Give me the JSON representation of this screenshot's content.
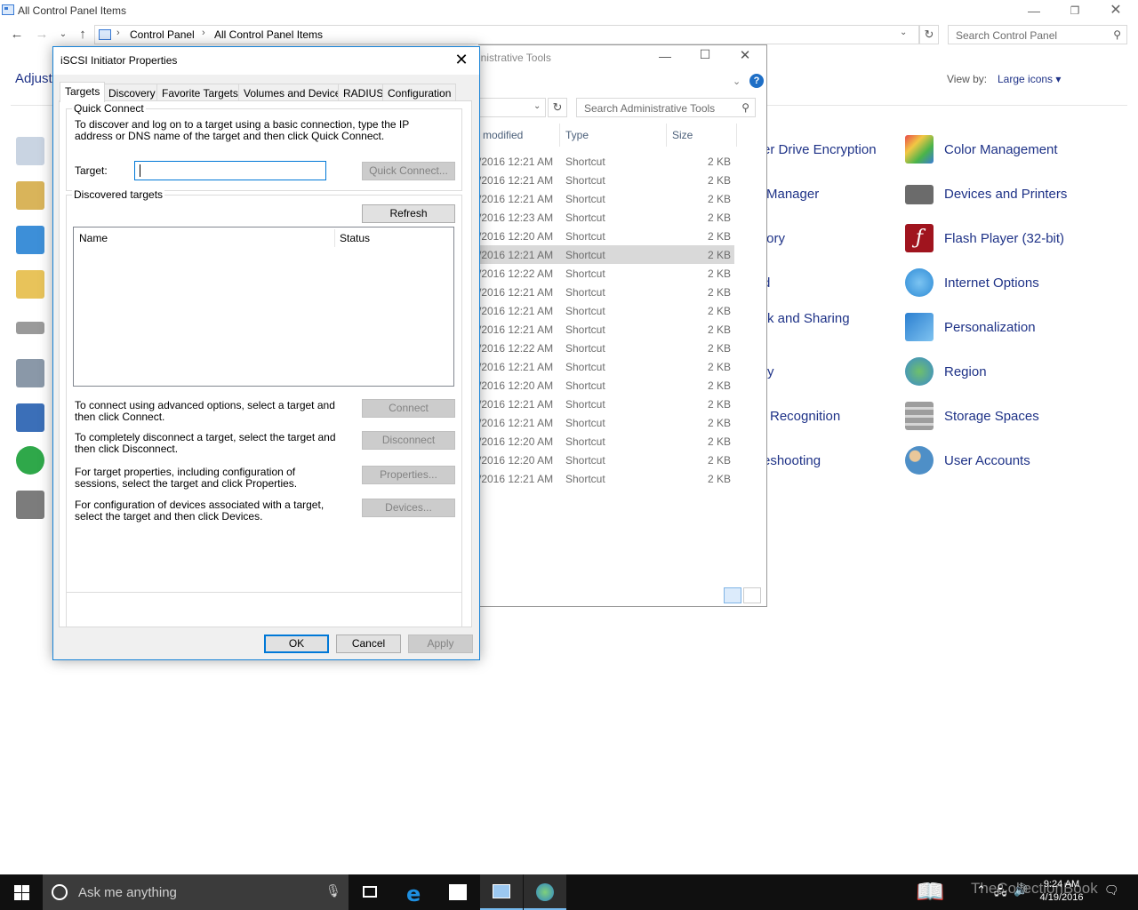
{
  "control_panel": {
    "window_title": "All Control Panel Items",
    "breadcrumb": [
      "Control Panel",
      "All Control Panel Items"
    ],
    "search_placeholder": "Search Control Panel",
    "heading": "Adjust",
    "view_by_label": "View by:",
    "view_by_value": "Large icons ▾",
    "right_column": [
      {
        "label": "Color Management",
        "icon": "color-management-icon",
        "color": "#5a8fd6"
      },
      {
        "label": "Devices and Printers",
        "icon": "printer-icon",
        "color": "#6b6b6b"
      },
      {
        "label": "Flash Player (32-bit)",
        "icon": "flash-icon",
        "color": "#a0141e"
      },
      {
        "label": "Internet Options",
        "icon": "internet-options-icon",
        "color": "#2e8bd6"
      },
      {
        "label": "Personalization",
        "icon": "personalization-icon",
        "color": "#2b7fd0"
      },
      {
        "label": "Region",
        "icon": "globe-clock-icon",
        "color": "#3a8ad0"
      },
      {
        "label": "Storage Spaces",
        "icon": "storage-icon",
        "color": "#8d8d8d"
      },
      {
        "label": "User Accounts",
        "icon": "users-icon",
        "color": "#4e8fc7"
      }
    ],
    "middle_column": [
      "er Drive Encryption",
      "Manager",
      "tory",
      "d",
      "rk and Sharing",
      "ry",
      "Recognition",
      "eshooting"
    ]
  },
  "admin_tools": {
    "title_fragment": "inistrative Tools",
    "search_placeholder": "Search Administrative Tools",
    "columns": [
      "modified",
      "Type",
      "Size"
    ],
    "rows": [
      {
        "date": "/2016 12:21 AM",
        "type": "Shortcut",
        "size": "2 KB"
      },
      {
        "date": "/2016 12:21 AM",
        "type": "Shortcut",
        "size": "2 KB"
      },
      {
        "date": "/2016 12:21 AM",
        "type": "Shortcut",
        "size": "2 KB"
      },
      {
        "date": "/2016 12:23 AM",
        "type": "Shortcut",
        "size": "2 KB"
      },
      {
        "date": "/2016 12:20 AM",
        "type": "Shortcut",
        "size": "2 KB"
      },
      {
        "date": "/2016 12:21 AM",
        "type": "Shortcut",
        "size": "2 KB"
      },
      {
        "date": "/2016 12:22 AM",
        "type": "Shortcut",
        "size": "2 KB"
      },
      {
        "date": "/2016 12:21 AM",
        "type": "Shortcut",
        "size": "2 KB"
      },
      {
        "date": "/2016 12:21 AM",
        "type": "Shortcut",
        "size": "2 KB"
      },
      {
        "date": "/2016 12:21 AM",
        "type": "Shortcut",
        "size": "2 KB"
      },
      {
        "date": "/2016 12:22 AM",
        "type": "Shortcut",
        "size": "2 KB"
      },
      {
        "date": "/2016 12:21 AM",
        "type": "Shortcut",
        "size": "2 KB"
      },
      {
        "date": "/2016 12:20 AM",
        "type": "Shortcut",
        "size": "2 KB"
      },
      {
        "date": "/2016 12:21 AM",
        "type": "Shortcut",
        "size": "2 KB"
      },
      {
        "date": "/2016 12:21 AM",
        "type": "Shortcut",
        "size": "2 KB"
      },
      {
        "date": "/2016 12:20 AM",
        "type": "Shortcut",
        "size": "2 KB"
      },
      {
        "date": "/2016 12:20 AM",
        "type": "Shortcut",
        "size": "2 KB"
      },
      {
        "date": "/2016 12:21 AM",
        "type": "Shortcut",
        "size": "2 KB"
      }
    ],
    "selected_row": 5
  },
  "dialog": {
    "title": "iSCSI Initiator Properties",
    "tabs": [
      "Targets",
      "Discovery",
      "Favorite Targets",
      "Volumes and Devices",
      "RADIUS",
      "Configuration"
    ],
    "active_tab": "Targets",
    "quick_connect": {
      "group_label": "Quick Connect",
      "description": "To discover and log on to a target using a basic connection, type the IP address or DNS name of the target and then click Quick Connect.",
      "target_label": "Target:",
      "target_value": "",
      "button": "Quick Connect..."
    },
    "discovered": {
      "group_label": "Discovered targets",
      "refresh_button": "Refresh",
      "columns": [
        "Name",
        "Status"
      ],
      "rows": []
    },
    "actions": [
      {
        "text": "To connect using advanced options, select a target and then click Connect.",
        "button": "Connect"
      },
      {
        "text": "To completely disconnect a target, select the target and then click Disconnect.",
        "button": "Disconnect"
      },
      {
        "text": "For target properties, including configuration of sessions, select the target and click Properties.",
        "button": "Properties..."
      },
      {
        "text": "For configuration of devices associated with a target, select the target and then click Devices.",
        "button": "Devices..."
      }
    ],
    "footer": {
      "ok": "OK",
      "cancel": "Cancel",
      "apply": "Apply"
    }
  },
  "taskbar": {
    "search_placeholder": "Ask me anything",
    "time": "9:24 AM",
    "date": "4/19/2016",
    "watermark": "TheCollectionBook",
    "accent": "#76b9ed"
  }
}
